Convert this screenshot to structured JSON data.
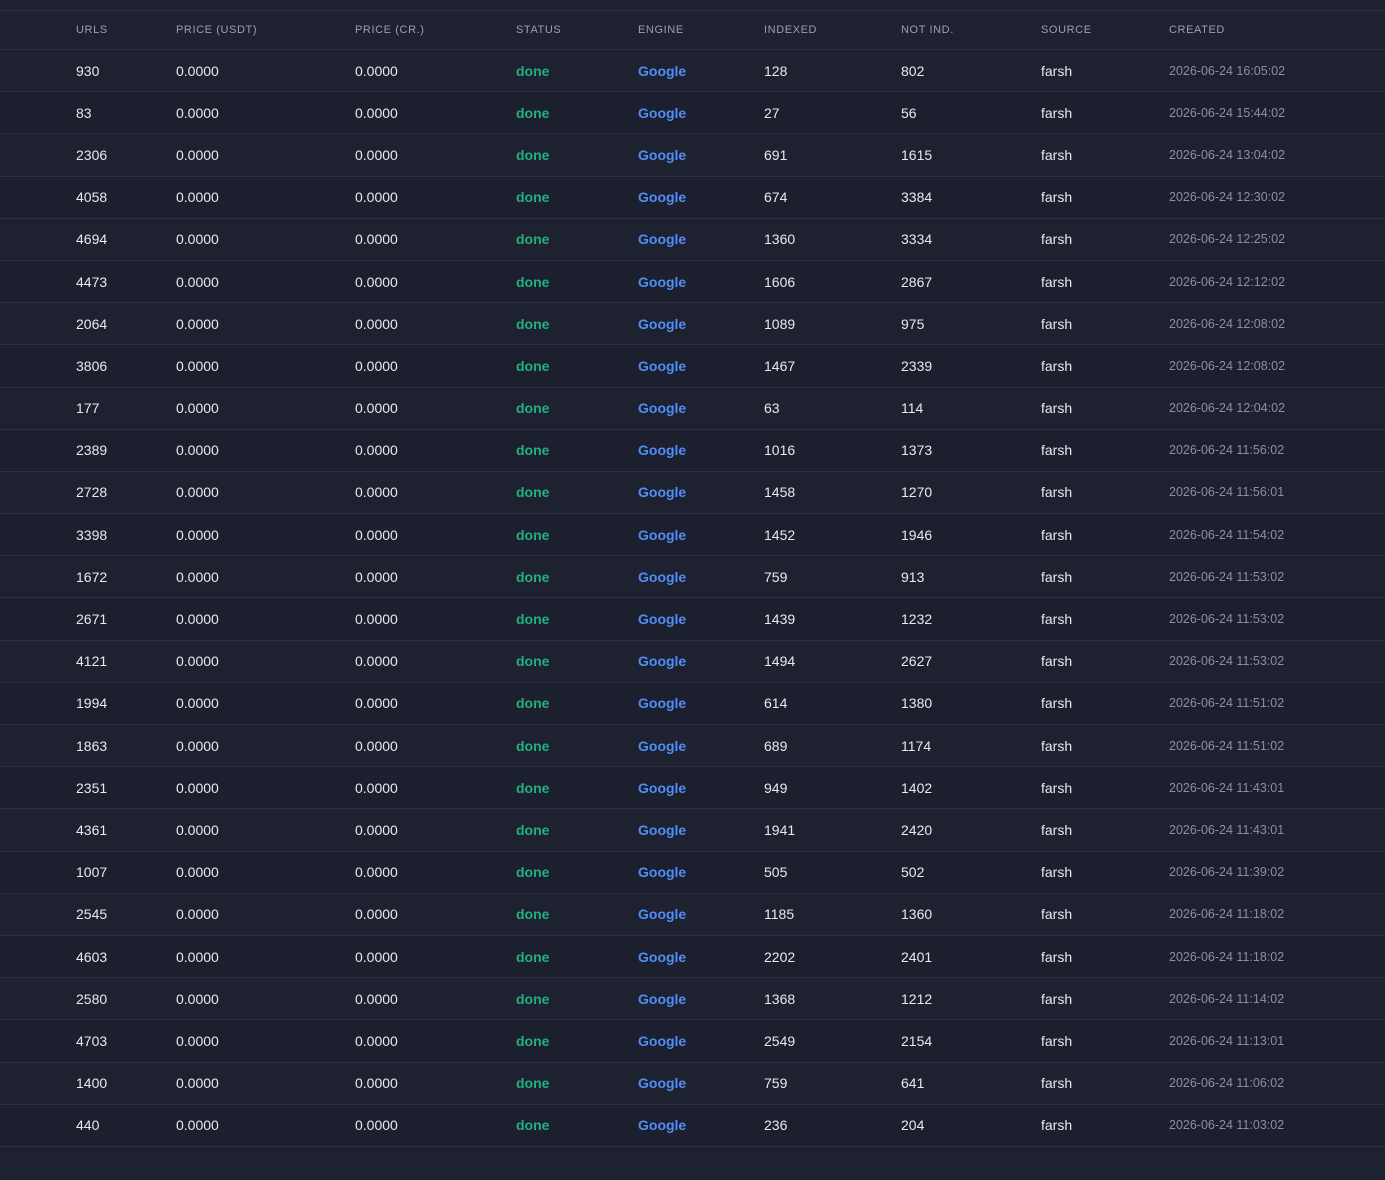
{
  "headers": {
    "urls": "URLS",
    "price_usdt": "PRICE (USDT)",
    "price_cr": "PRICE (CR.)",
    "status": "STATUS",
    "engine": "ENGINE",
    "indexed": "INDEXED",
    "not_ind": "NOT IND.",
    "source": "SOURCE",
    "created": "CREATED"
  },
  "colors": {
    "background": "#1e2130",
    "status_done": "#22b07d",
    "engine_link": "#4f8ef7"
  },
  "rows": [
    {
      "urls": "930",
      "price_usdt": "0.0000",
      "price_cr": "0.0000",
      "status": "done",
      "engine": "Google",
      "indexed": "128",
      "not_ind": "802",
      "source": "farsh",
      "created": "2026-06-24 16:05:02"
    },
    {
      "urls": "83",
      "price_usdt": "0.0000",
      "price_cr": "0.0000",
      "status": "done",
      "engine": "Google",
      "indexed": "27",
      "not_ind": "56",
      "source": "farsh",
      "created": "2026-06-24 15:44:02"
    },
    {
      "urls": "2306",
      "price_usdt": "0.0000",
      "price_cr": "0.0000",
      "status": "done",
      "engine": "Google",
      "indexed": "691",
      "not_ind": "1615",
      "source": "farsh",
      "created": "2026-06-24 13:04:02"
    },
    {
      "urls": "4058",
      "price_usdt": "0.0000",
      "price_cr": "0.0000",
      "status": "done",
      "engine": "Google",
      "indexed": "674",
      "not_ind": "3384",
      "source": "farsh",
      "created": "2026-06-24 12:30:02"
    },
    {
      "urls": "4694",
      "price_usdt": "0.0000",
      "price_cr": "0.0000",
      "status": "done",
      "engine": "Google",
      "indexed": "1360",
      "not_ind": "3334",
      "source": "farsh",
      "created": "2026-06-24 12:25:02"
    },
    {
      "urls": "4473",
      "price_usdt": "0.0000",
      "price_cr": "0.0000",
      "status": "done",
      "engine": "Google",
      "indexed": "1606",
      "not_ind": "2867",
      "source": "farsh",
      "created": "2026-06-24 12:12:02"
    },
    {
      "urls": "2064",
      "price_usdt": "0.0000",
      "price_cr": "0.0000",
      "status": "done",
      "engine": "Google",
      "indexed": "1089",
      "not_ind": "975",
      "source": "farsh",
      "created": "2026-06-24 12:08:02"
    },
    {
      "urls": "3806",
      "price_usdt": "0.0000",
      "price_cr": "0.0000",
      "status": "done",
      "engine": "Google",
      "indexed": "1467",
      "not_ind": "2339",
      "source": "farsh",
      "created": "2026-06-24 12:08:02"
    },
    {
      "urls": "177",
      "price_usdt": "0.0000",
      "price_cr": "0.0000",
      "status": "done",
      "engine": "Google",
      "indexed": "63",
      "not_ind": "114",
      "source": "farsh",
      "created": "2026-06-24 12:04:02"
    },
    {
      "urls": "2389",
      "price_usdt": "0.0000",
      "price_cr": "0.0000",
      "status": "done",
      "engine": "Google",
      "indexed": "1016",
      "not_ind": "1373",
      "source": "farsh",
      "created": "2026-06-24 11:56:02"
    },
    {
      "urls": "2728",
      "price_usdt": "0.0000",
      "price_cr": "0.0000",
      "status": "done",
      "engine": "Google",
      "indexed": "1458",
      "not_ind": "1270",
      "source": "farsh",
      "created": "2026-06-24 11:56:01"
    },
    {
      "urls": "3398",
      "price_usdt": "0.0000",
      "price_cr": "0.0000",
      "status": "done",
      "engine": "Google",
      "indexed": "1452",
      "not_ind": "1946",
      "source": "farsh",
      "created": "2026-06-24 11:54:02"
    },
    {
      "urls": "1672",
      "price_usdt": "0.0000",
      "price_cr": "0.0000",
      "status": "done",
      "engine": "Google",
      "indexed": "759",
      "not_ind": "913",
      "source": "farsh",
      "created": "2026-06-24 11:53:02"
    },
    {
      "urls": "2671",
      "price_usdt": "0.0000",
      "price_cr": "0.0000",
      "status": "done",
      "engine": "Google",
      "indexed": "1439",
      "not_ind": "1232",
      "source": "farsh",
      "created": "2026-06-24 11:53:02"
    },
    {
      "urls": "4121",
      "price_usdt": "0.0000",
      "price_cr": "0.0000",
      "status": "done",
      "engine": "Google",
      "indexed": "1494",
      "not_ind": "2627",
      "source": "farsh",
      "created": "2026-06-24 11:53:02"
    },
    {
      "urls": "1994",
      "price_usdt": "0.0000",
      "price_cr": "0.0000",
      "status": "done",
      "engine": "Google",
      "indexed": "614",
      "not_ind": "1380",
      "source": "farsh",
      "created": "2026-06-24 11:51:02"
    },
    {
      "urls": "1863",
      "price_usdt": "0.0000",
      "price_cr": "0.0000",
      "status": "done",
      "engine": "Google",
      "indexed": "689",
      "not_ind": "1174",
      "source": "farsh",
      "created": "2026-06-24 11:51:02"
    },
    {
      "urls": "2351",
      "price_usdt": "0.0000",
      "price_cr": "0.0000",
      "status": "done",
      "engine": "Google",
      "indexed": "949",
      "not_ind": "1402",
      "source": "farsh",
      "created": "2026-06-24 11:43:01"
    },
    {
      "urls": "4361",
      "price_usdt": "0.0000",
      "price_cr": "0.0000",
      "status": "done",
      "engine": "Google",
      "indexed": "1941",
      "not_ind": "2420",
      "source": "farsh",
      "created": "2026-06-24 11:43:01"
    },
    {
      "urls": "1007",
      "price_usdt": "0.0000",
      "price_cr": "0.0000",
      "status": "done",
      "engine": "Google",
      "indexed": "505",
      "not_ind": "502",
      "source": "farsh",
      "created": "2026-06-24 11:39:02"
    },
    {
      "urls": "2545",
      "price_usdt": "0.0000",
      "price_cr": "0.0000",
      "status": "done",
      "engine": "Google",
      "indexed": "1185",
      "not_ind": "1360",
      "source": "farsh",
      "created": "2026-06-24 11:18:02"
    },
    {
      "urls": "4603",
      "price_usdt": "0.0000",
      "price_cr": "0.0000",
      "status": "done",
      "engine": "Google",
      "indexed": "2202",
      "not_ind": "2401",
      "source": "farsh",
      "created": "2026-06-24 11:18:02"
    },
    {
      "urls": "2580",
      "price_usdt": "0.0000",
      "price_cr": "0.0000",
      "status": "done",
      "engine": "Google",
      "indexed": "1368",
      "not_ind": "1212",
      "source": "farsh",
      "created": "2026-06-24 11:14:02"
    },
    {
      "urls": "4703",
      "price_usdt": "0.0000",
      "price_cr": "0.0000",
      "status": "done",
      "engine": "Google",
      "indexed": "2549",
      "not_ind": "2154",
      "source": "farsh",
      "created": "2026-06-24 11:13:01"
    },
    {
      "urls": "1400",
      "price_usdt": "0.0000",
      "price_cr": "0.0000",
      "status": "done",
      "engine": "Google",
      "indexed": "759",
      "not_ind": "641",
      "source": "farsh",
      "created": "2026-06-24 11:06:02"
    },
    {
      "urls": "440",
      "price_usdt": "0.0000",
      "price_cr": "0.0000",
      "status": "done",
      "engine": "Google",
      "indexed": "236",
      "not_ind": "204",
      "source": "farsh",
      "created": "2026-06-24 11:03:02"
    }
  ]
}
